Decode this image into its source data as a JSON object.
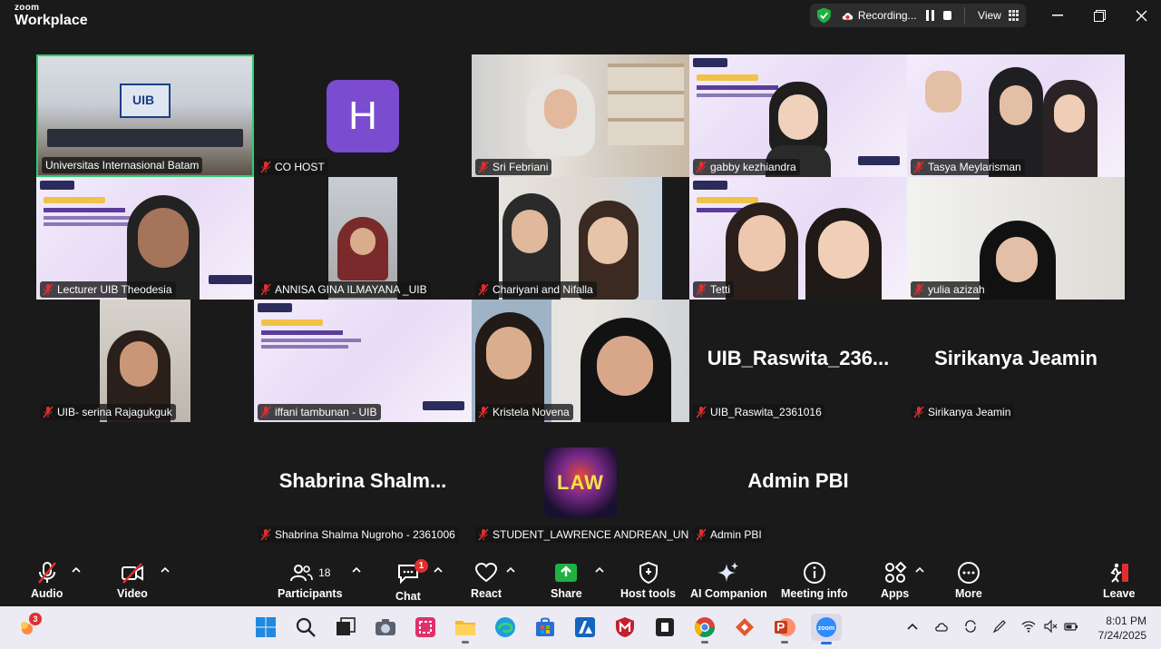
{
  "app": {
    "brand_top": "zoom",
    "brand_bottom": "Workplace"
  },
  "recording": {
    "label": "Recording...",
    "view_label": "View"
  },
  "participants": [
    {
      "name": "Universitas Internasional Batam",
      "muted": false
    },
    {
      "name": "CO HOST",
      "muted": true,
      "avatar_letter": "H"
    },
    {
      "name": "Sri Febriani",
      "muted": true
    },
    {
      "name": "gabby kezhiandra",
      "muted": true
    },
    {
      "name": "Tasya Meylarisman",
      "muted": true
    },
    {
      "name": "Lecturer UIB Theodesia",
      "muted": true
    },
    {
      "name": "ANNISA GINA ILMAYANA _UIB",
      "muted": true
    },
    {
      "name": "Chariyani and Nifalla",
      "muted": true
    },
    {
      "name": "Tetti",
      "muted": true
    },
    {
      "name": "yulia azizah",
      "muted": true
    },
    {
      "name": "UIB- serina Rajagukguk",
      "muted": true
    },
    {
      "name": "iffani tambunan - UIB",
      "muted": true
    },
    {
      "name": "Kristela Novena",
      "muted": true
    },
    {
      "name": "UIB_Raswita_2361016",
      "muted": true,
      "display": "UIB_Raswita_236..."
    },
    {
      "name": "Sirikanya Jeamin",
      "muted": true,
      "display": "Sirikanya Jeamin"
    },
    {
      "name": "Shabrina Shalma Nugroho - 2361006",
      "muted": true,
      "display": "Shabrina  Shalm..."
    },
    {
      "name": "STUDENT_LAWRENCE ANDREAN_UN...",
      "muted": true,
      "avatar_text": "LAW"
    },
    {
      "name": "Admin PBI",
      "muted": true,
      "display": "Admin PBI"
    }
  ],
  "toolbar": {
    "audio": "Audio",
    "video": "Video",
    "participants": "Participants",
    "participants_count": "18",
    "chat": "Chat",
    "chat_badge": "1",
    "react": "React",
    "share": "Share",
    "host_tools": "Host tools",
    "ai_companion": "AI Companion",
    "meeting_info": "Meeting info",
    "apps": "Apps",
    "more": "More",
    "leave": "Leave"
  },
  "taskbar": {
    "notification_count": "3",
    "time": "8:01 PM",
    "date": "7/24/2025"
  },
  "colors": {
    "active_speaker": "#2ecc71",
    "muted_red": "#e02f2f",
    "share_green": "#1fb141",
    "avatar_purple": "#7b4bd0"
  }
}
